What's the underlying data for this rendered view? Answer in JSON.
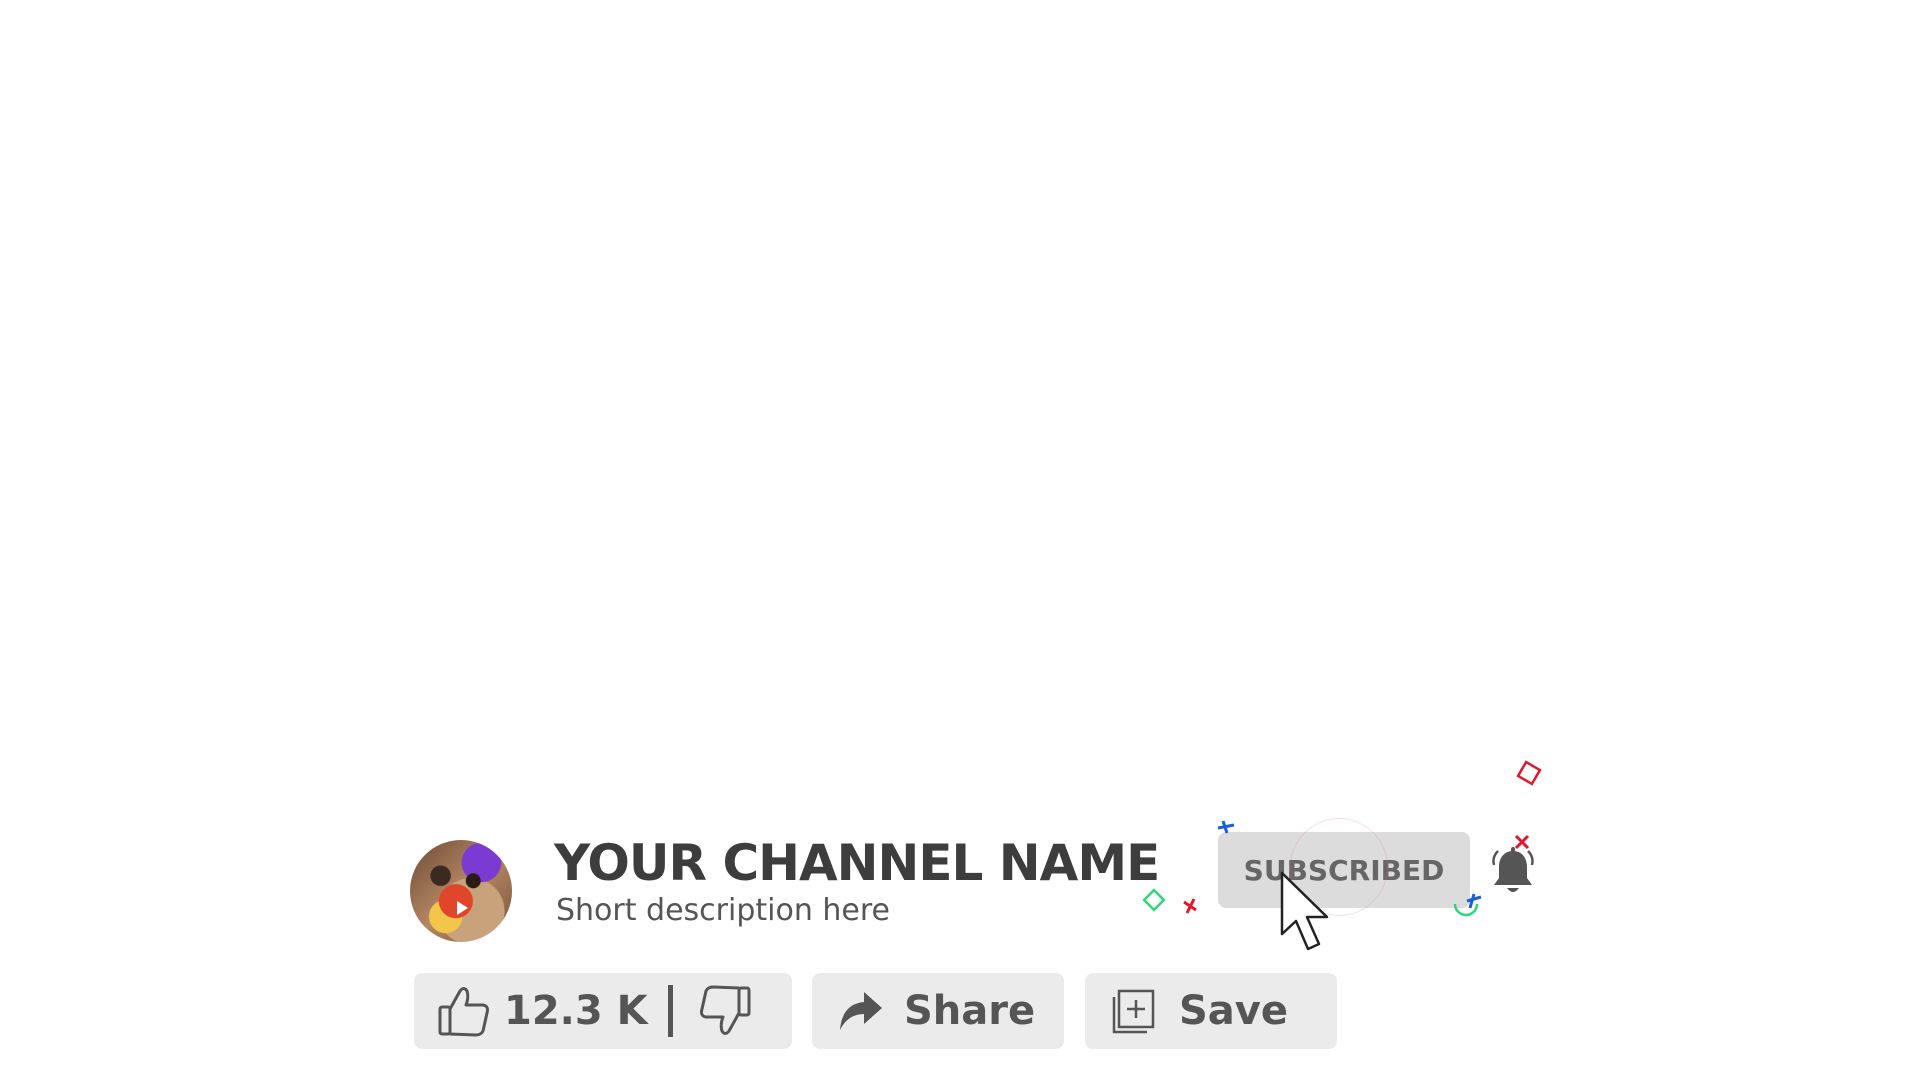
{
  "channel": {
    "name": "YOUR CHANNEL NAME",
    "description": "Short description here"
  },
  "subscribe": {
    "label": "SUBSCRIBED"
  },
  "actions": {
    "like_count": "12.3 K",
    "share_label": "Share",
    "save_label": "Save"
  },
  "icons": {
    "like": "thumbs-up-icon",
    "dislike": "thumbs-down-icon",
    "share": "share-arrow-icon",
    "save": "playlist-add-icon",
    "bell": "bell-icon",
    "cursor": "mouse-pointer-icon"
  },
  "colors": {
    "text_dark": "#3d3d3d",
    "button_bg": "#dcdcdc",
    "pill_bg": "#ebebeb",
    "confetti_red": "#e0182a",
    "confetti_green": "#2fd67a",
    "confetti_blue": "#1a5fd6"
  }
}
